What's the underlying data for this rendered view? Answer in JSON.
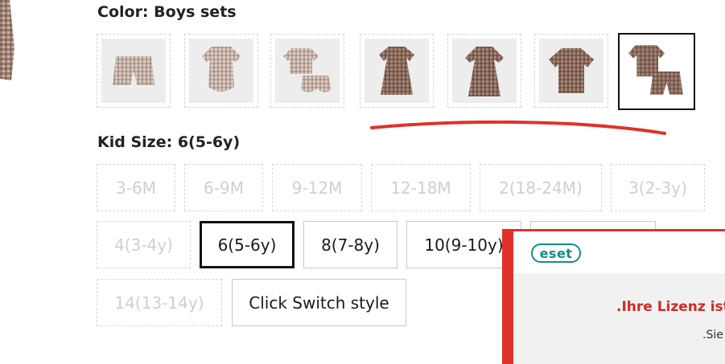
{
  "color_section": {
    "label_key": "Color:",
    "label_value": "Boys sets"
  },
  "swatches": [
    {
      "name": "shorts"
    },
    {
      "name": "romper"
    },
    {
      "name": "top-and-bloomers"
    },
    {
      "name": "dress-puff"
    },
    {
      "name": "dress-tiered"
    },
    {
      "name": "shirt"
    },
    {
      "name": "boys-set",
      "selected": true
    }
  ],
  "size_section": {
    "label_key": "Kid Size:",
    "label_value": "6(5-6y)"
  },
  "sizes": [
    {
      "label": "3-6M",
      "state": "unavailable"
    },
    {
      "label": "6-9M",
      "state": "unavailable"
    },
    {
      "label": "9-12M",
      "state": "unavailable"
    },
    {
      "label": "12-18M",
      "state": "unavailable"
    },
    {
      "label": "2(18-24M)",
      "state": "unavailable"
    },
    {
      "label": "3(2-3y)",
      "state": "unavailable"
    },
    {
      "label": "4(3-4y)",
      "state": "unavailable"
    },
    {
      "label": "6(5-6y)",
      "state": "selected"
    },
    {
      "label": "8(7-8y)",
      "state": "available"
    },
    {
      "label": "10(9-10y)",
      "state": "available"
    },
    {
      "label": "",
      "state": "available"
    },
    {
      "label": "14(13-14y)",
      "state": "unavailable"
    },
    {
      "label": "Click Switch style",
      "state": "available"
    }
  ],
  "eset_popup": {
    "logo": "eset",
    "title": ".Ihre Lizenz ist",
    "subtitle": ".Sie s"
  },
  "colors": {
    "accent_red": "#e0312b",
    "eset_teal": "#0f8f88",
    "selected_border": "#111111",
    "disabled_text": "#cfcfcf"
  }
}
